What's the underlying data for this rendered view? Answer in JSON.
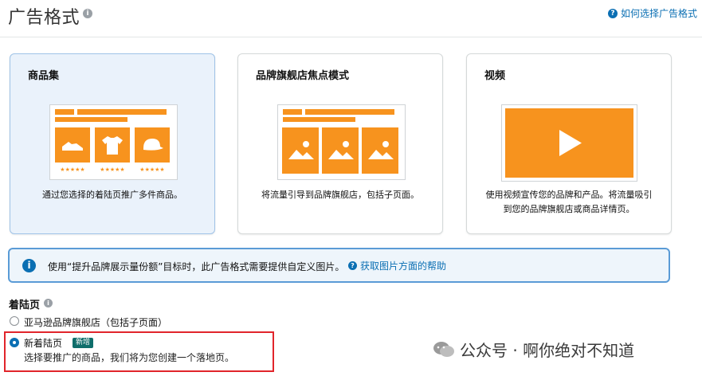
{
  "header": {
    "title": "广告格式",
    "help_link": "如何选择广告格式"
  },
  "cards": [
    {
      "title": "商品集",
      "desc": "通过您选择的着陆页推广多件商品。",
      "selected": true
    },
    {
      "title": "品牌旗舰店焦点模式",
      "desc": "将流量引导到品牌旗舰店，包括子页面。",
      "selected": false
    },
    {
      "title": "视频",
      "desc_line1": "使用视频宣传您的品牌和产品。将流量吸引",
      "desc_line2": "到您的品牌旗舰店或商品详情页。",
      "selected": false
    }
  ],
  "info_banner": {
    "text": "使用“提升品牌展示量份额”目标时，此广告格式需要提供自定义图片。",
    "help_link": "获取图片方面的帮助"
  },
  "landing": {
    "title": "着陆页",
    "options": [
      {
        "label": "亚马逊品牌旗舰店（包括子页面）",
        "selected": false
      },
      {
        "label": "新着陆页",
        "badge": "新增",
        "desc": "选择要推广的商品，我们将为您创建一个落地页。",
        "selected": true
      }
    ]
  },
  "watermark": "公众号 · 啊你绝对不知道",
  "colors": {
    "accent": "#f7931e",
    "link": "#0b6fb3",
    "selected_card_bg": "#eaf2fb",
    "highlight": "#e1252b",
    "badge": "#0f6e6b"
  }
}
